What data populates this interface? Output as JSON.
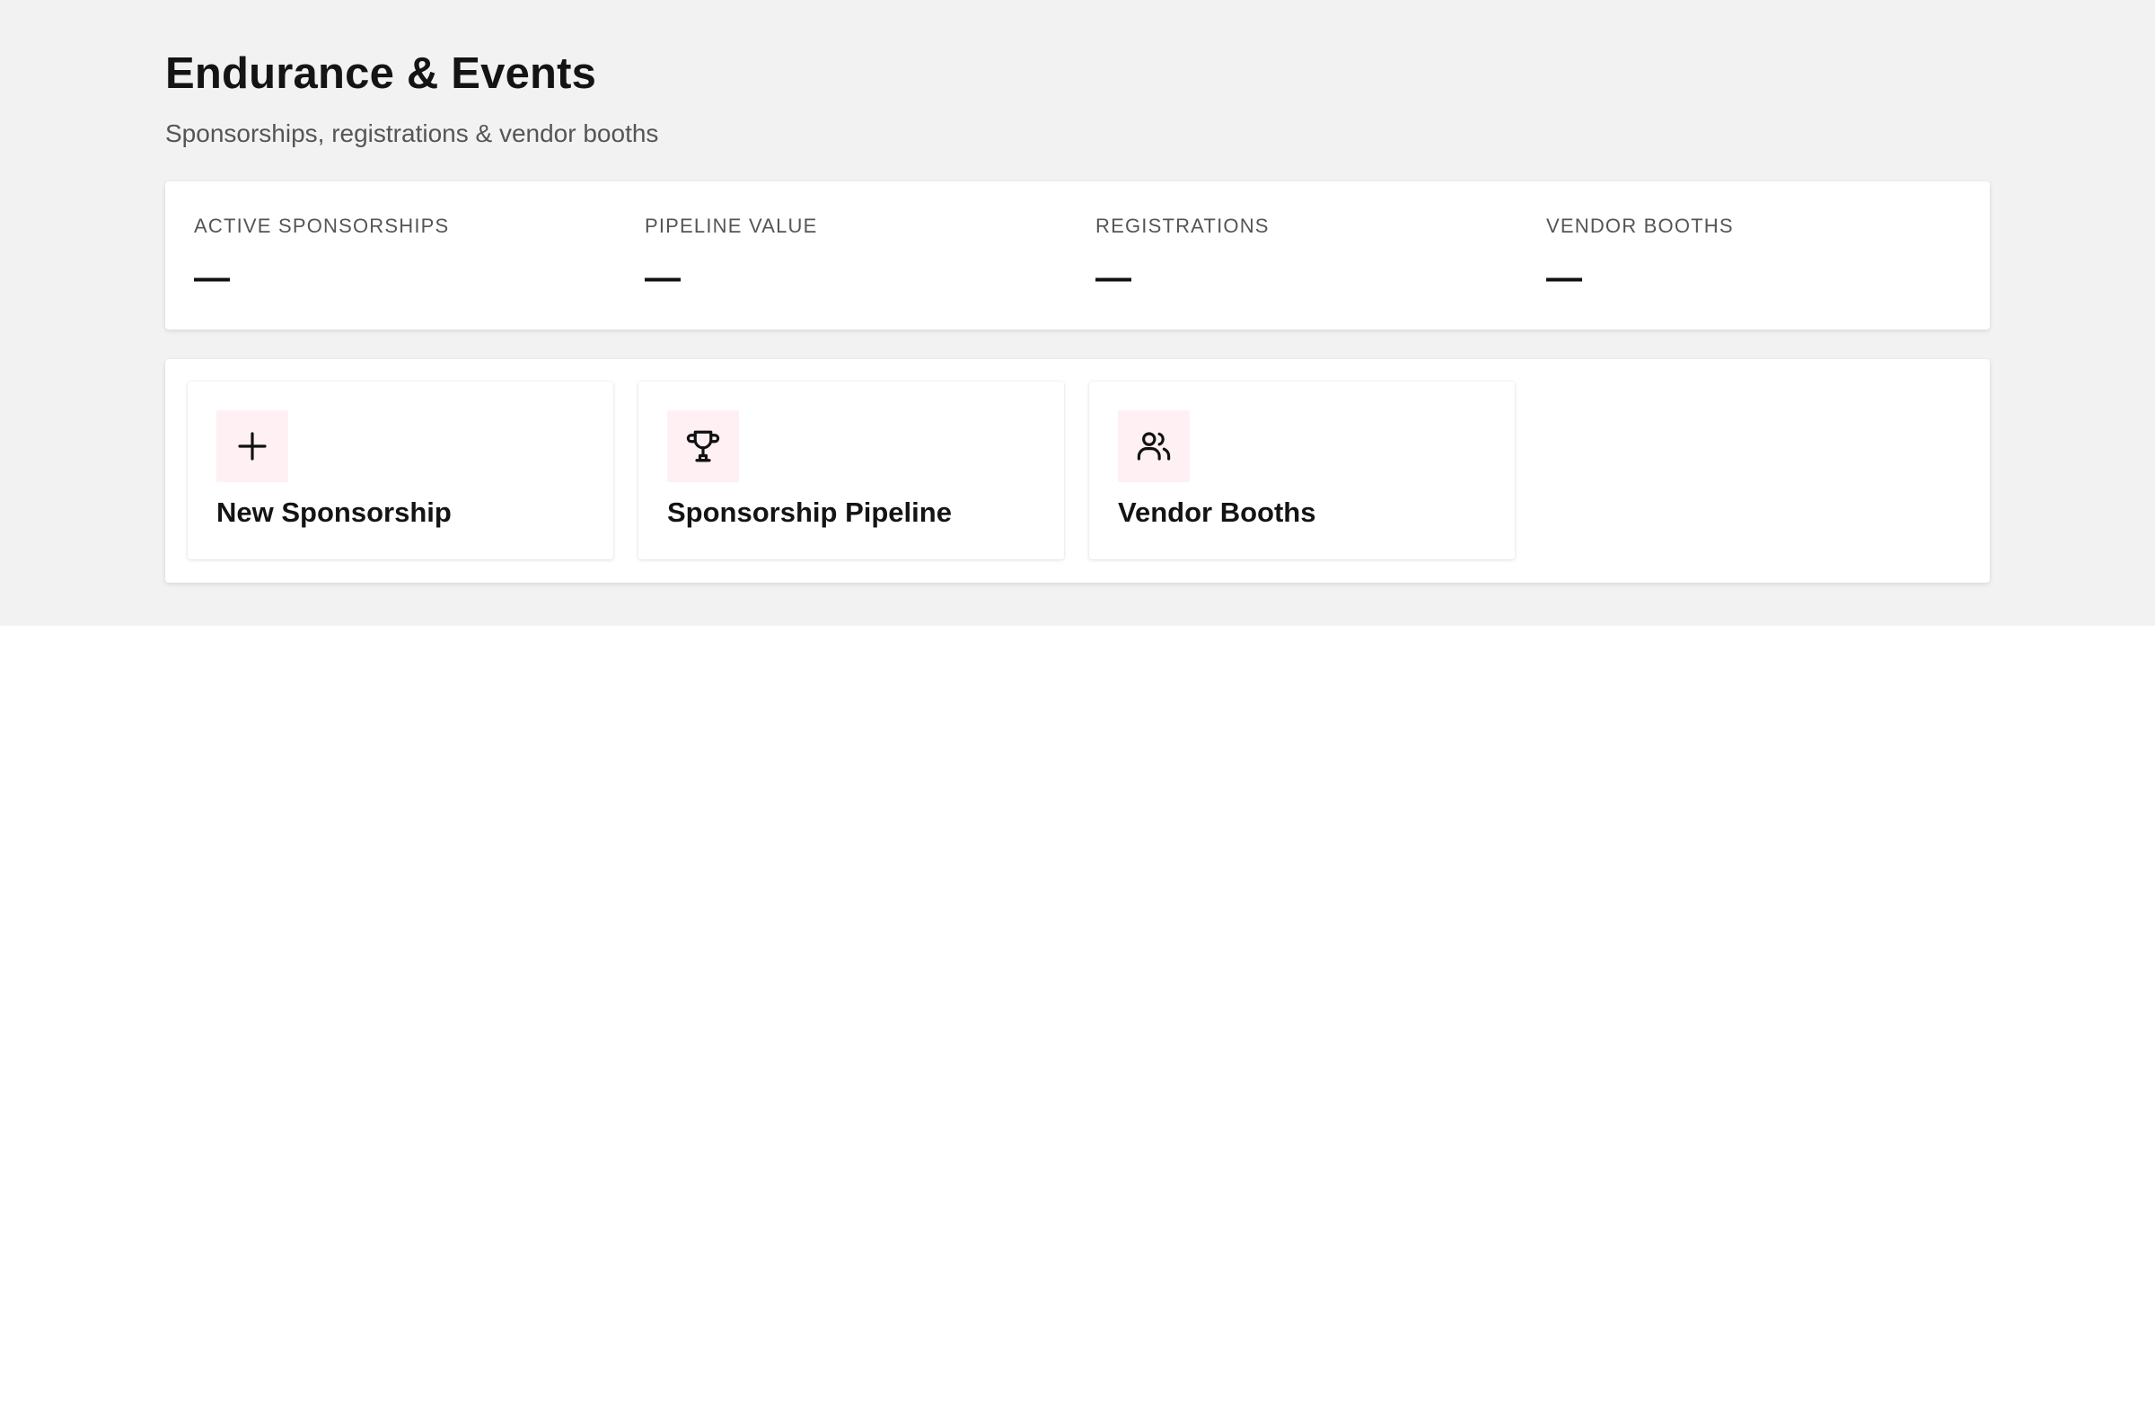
{
  "header": {
    "title": "Endurance & Events",
    "subtitle": "Sponsorships, registrations & vendor booths"
  },
  "stats": [
    {
      "label": "ACTIVE SPONSORSHIPS",
      "value": "—"
    },
    {
      "label": "PIPELINE VALUE",
      "value": "—"
    },
    {
      "label": "REGISTRATIONS",
      "value": "—"
    },
    {
      "label": "VENDOR BOOTHS",
      "value": "—"
    }
  ],
  "actions": [
    {
      "label": "New Sponsorship",
      "icon": "plus-icon"
    },
    {
      "label": "Sponsorship Pipeline",
      "icon": "trophy-icon"
    },
    {
      "label": "Vendor Booths",
      "icon": "users-icon"
    }
  ],
  "colors": {
    "page_background": "#f2f2f2",
    "icon_tile_background": "#fff0f3",
    "card_background": "#ffffff"
  }
}
